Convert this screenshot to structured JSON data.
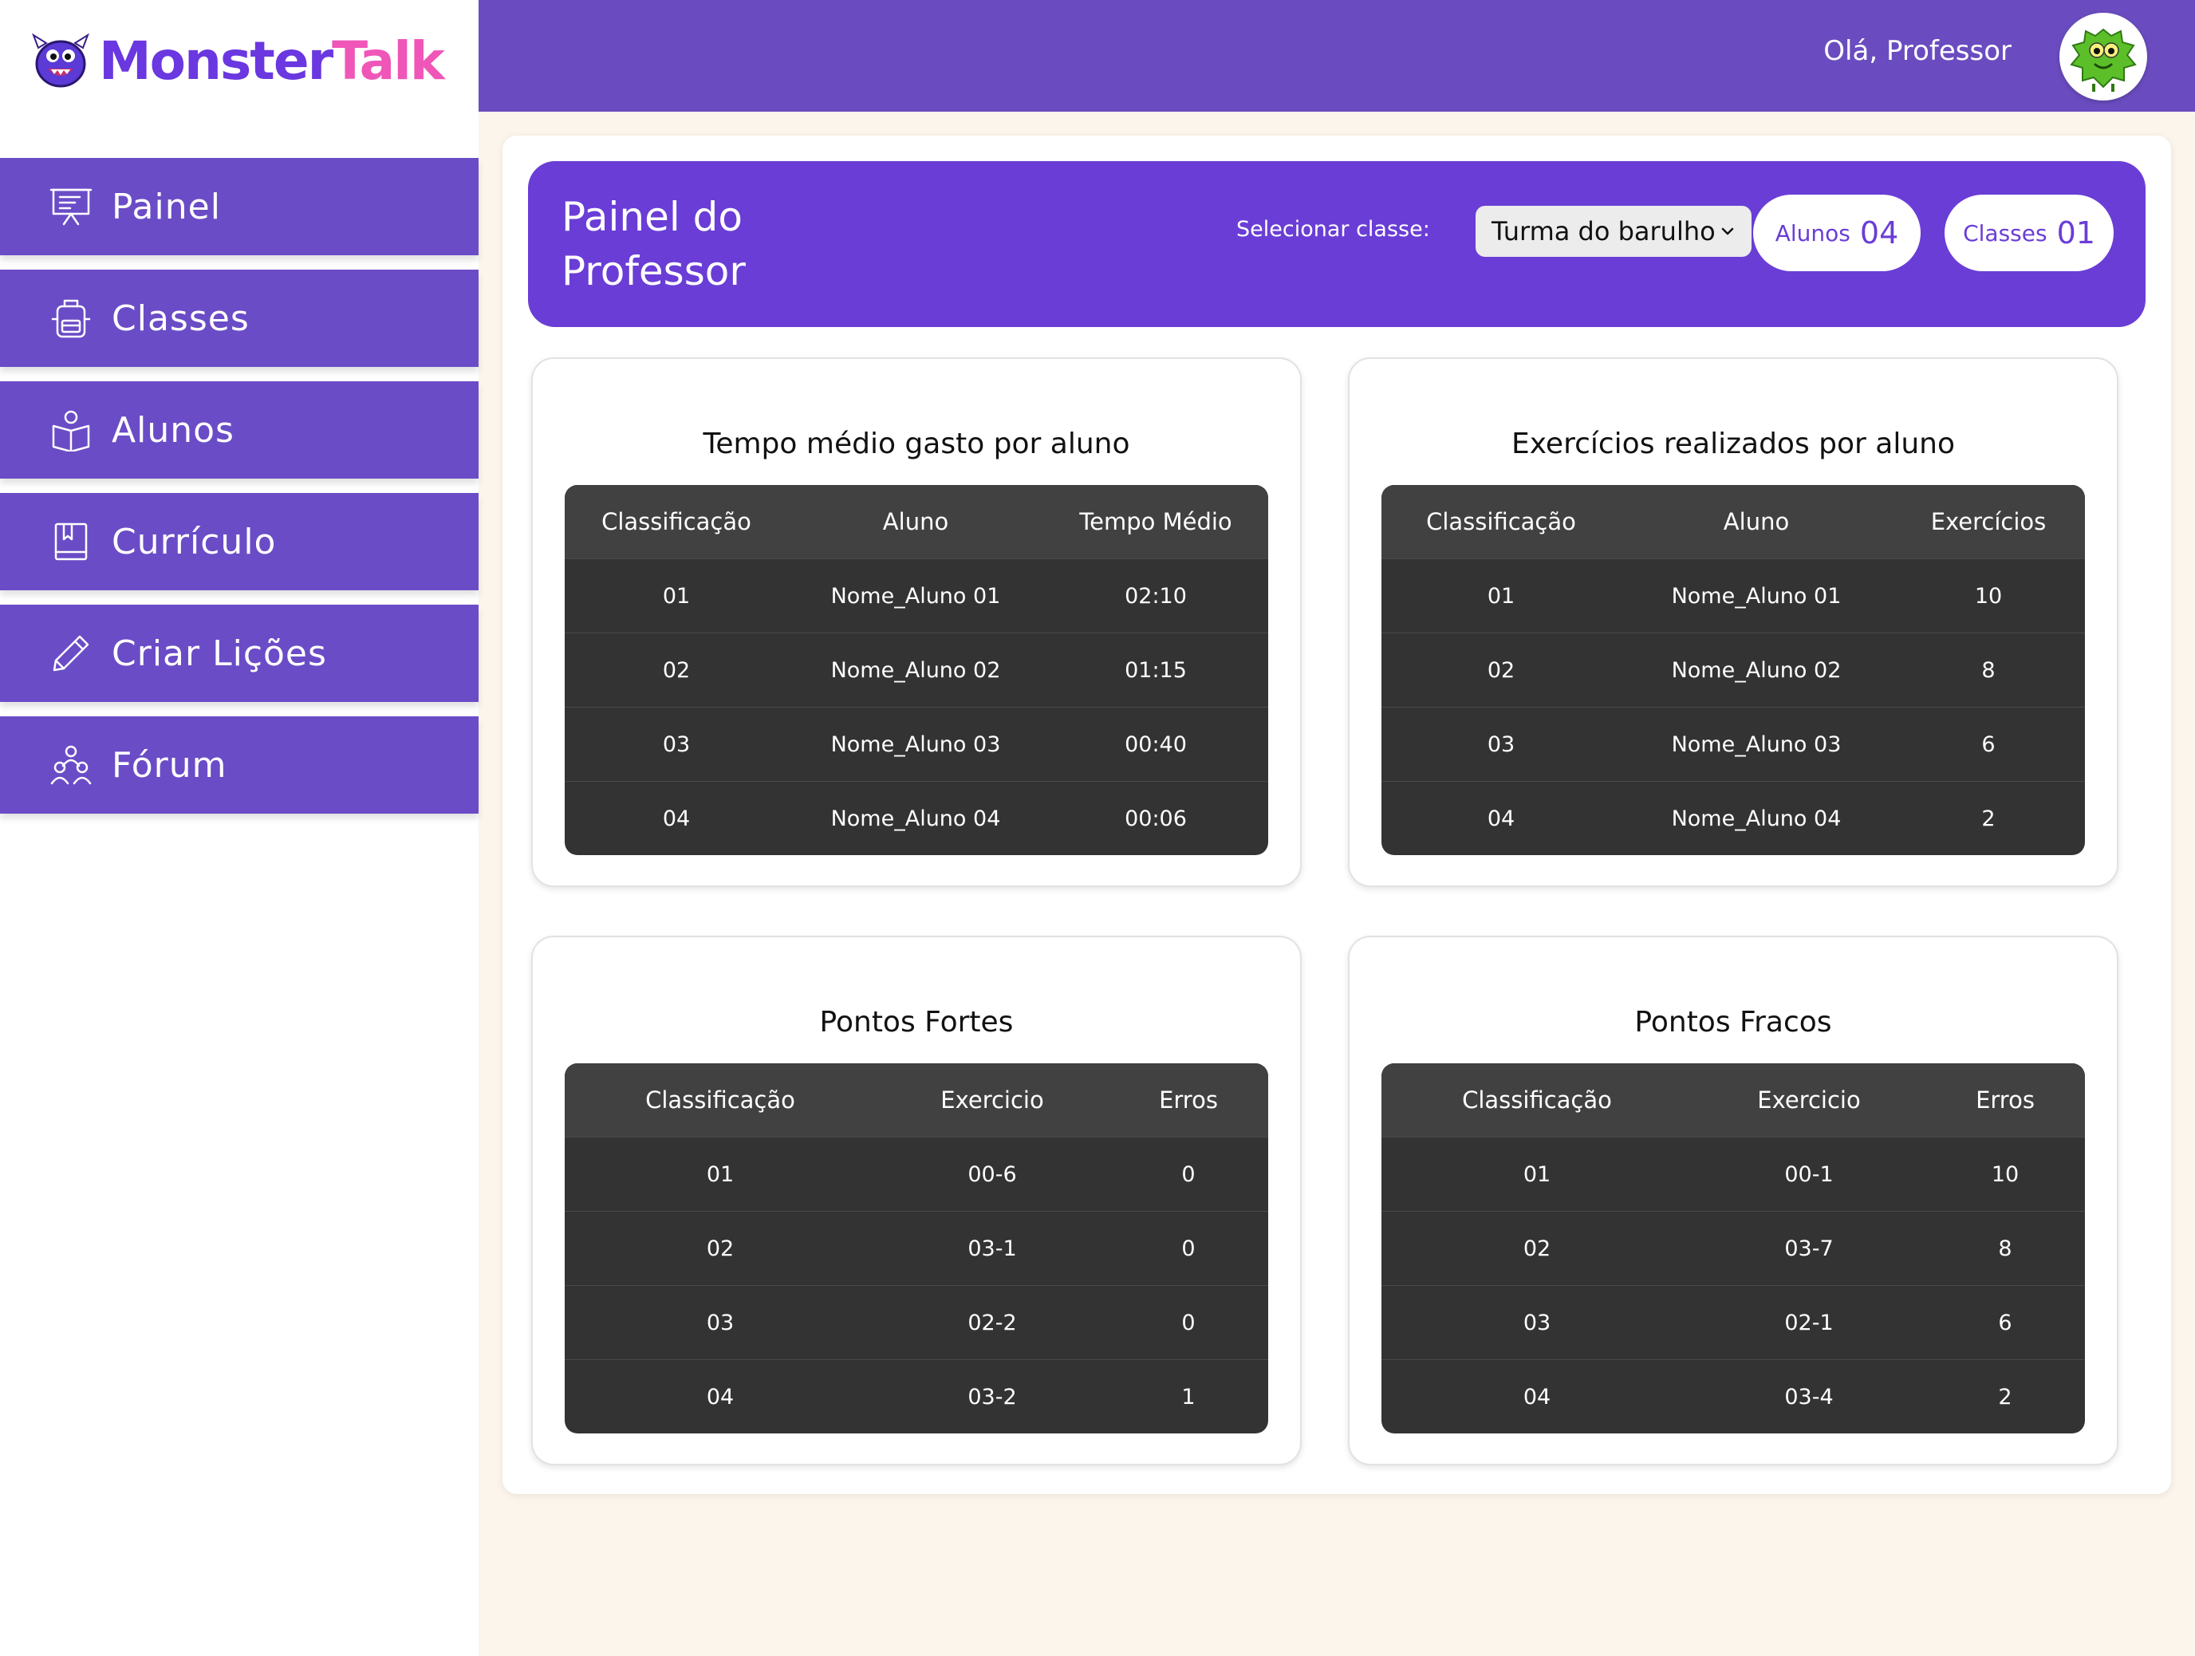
{
  "app": {
    "logo_part1": "Monster",
    "logo_part2": "Talk",
    "brand_purple": "#6a37e0",
    "brand_pink": "#ef56b8"
  },
  "sidebar": {
    "items": [
      {
        "label": "Painel",
        "icon": "presentation-board-icon"
      },
      {
        "label": "Classes",
        "icon": "backpack-icon"
      },
      {
        "label": "Alunos",
        "icon": "student-book-icon"
      },
      {
        "label": "Currículo",
        "icon": "bookmark-book-icon"
      },
      {
        "label": "Criar Lições",
        "icon": "pencil-icon"
      },
      {
        "label": "Fórum",
        "icon": "people-group-icon"
      }
    ]
  },
  "header": {
    "greeting": "Olá, Professor",
    "avatar_icon": "monster-avatar-icon"
  },
  "hero": {
    "title": "Painel do Professor",
    "select_label": "Selecionar classe:",
    "selected_class": "Turma do barulho",
    "alunos_label": "Alunos",
    "alunos_value": "04",
    "classes_label": "Classes",
    "classes_value": "01"
  },
  "cards": [
    {
      "title": "Tempo médio gasto por aluno",
      "headers": [
        "Classificação",
        "Aluno",
        "Tempo Médio"
      ],
      "rows": [
        [
          "01",
          "Nome_Aluno 01",
          "02:10"
        ],
        [
          "02",
          "Nome_Aluno 02",
          "01:15"
        ],
        [
          "03",
          "Nome_Aluno 03",
          "00:40"
        ],
        [
          "04",
          "Nome_Aluno 04",
          "00:06"
        ]
      ]
    },
    {
      "title": "Exercícios realizados por aluno",
      "headers": [
        "Classificação",
        "Aluno",
        "Exercícios"
      ],
      "rows": [
        [
          "01",
          "Nome_Aluno 01",
          "10"
        ],
        [
          "02",
          "Nome_Aluno 02",
          "8"
        ],
        [
          "03",
          "Nome_Aluno 03",
          "6"
        ],
        [
          "04",
          "Nome_Aluno 04",
          "2"
        ]
      ]
    },
    {
      "title": "Pontos Fortes",
      "headers": [
        "Classificação",
        "Exercicio",
        "Erros"
      ],
      "rows": [
        [
          "01",
          "00-6",
          "0"
        ],
        [
          "02",
          "03-1",
          "0"
        ],
        [
          "03",
          "02-2",
          "0"
        ],
        [
          "04",
          "03-2",
          "1"
        ]
      ]
    },
    {
      "title": "Pontos Fracos",
      "headers": [
        "Classificação",
        "Exercicio",
        "Erros"
      ],
      "rows": [
        [
          "01",
          "00-1",
          "10"
        ],
        [
          "02",
          "03-7",
          "8"
        ],
        [
          "03",
          "02-1",
          "6"
        ],
        [
          "04",
          "03-4",
          "2"
        ]
      ]
    }
  ]
}
